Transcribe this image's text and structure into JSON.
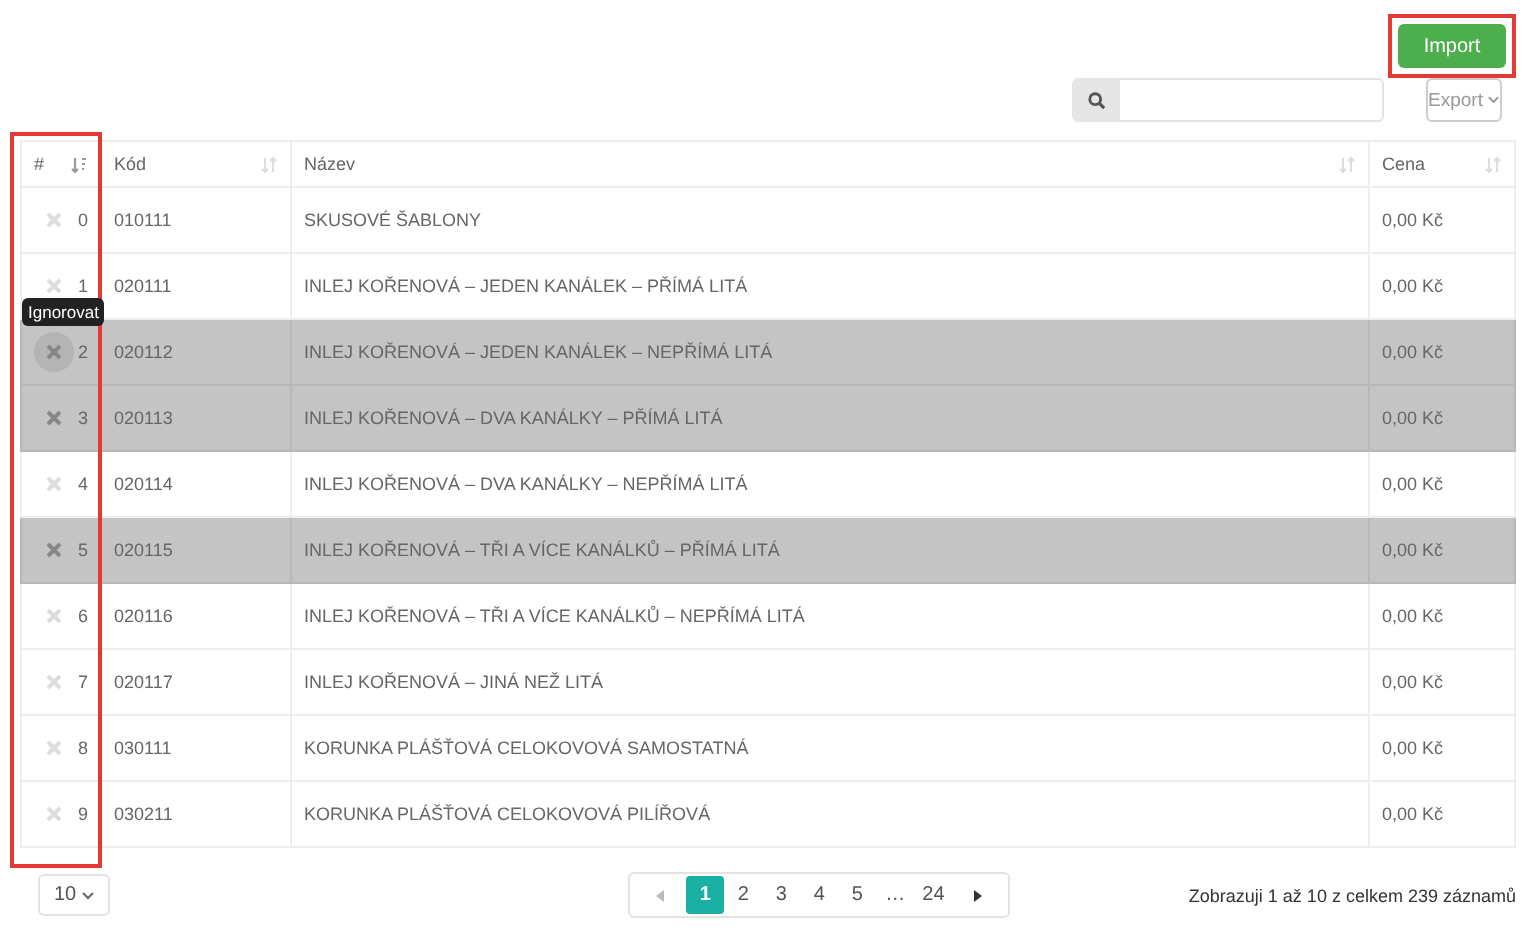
{
  "toolbar": {
    "import_button": {
      "label": "Import",
      "highlighted": true
    },
    "export_button": {
      "label": "Export"
    }
  },
  "table": {
    "first_column_highlighted": true,
    "columns": [
      {
        "label": "#",
        "sorted": true
      },
      {
        "label": "Kód",
        "sorted": false
      },
      {
        "label": "Název",
        "sorted": false
      },
      {
        "label": "Cena",
        "sorted": false
      }
    ],
    "rows": [
      {
        "index": "0",
        "code": "010111",
        "name": "SKUSOVÉ ŠABLONY",
        "price": "0,00 Kč",
        "ignored": false,
        "hovered": false
      },
      {
        "index": "1",
        "code": "020111",
        "name": "INLEJ KOŘENOVÁ – JEDEN KANÁLEK – PŘÍMÁ LITÁ",
        "price": "0,00 Kč",
        "ignored": false,
        "hovered": false
      },
      {
        "index": "2",
        "code": "020112",
        "name": "INLEJ KOŘENOVÁ – JEDEN KANÁLEK – NEPŘÍMÁ LITÁ",
        "price": "0,00 Kč",
        "ignored": true,
        "hovered": true
      },
      {
        "index": "3",
        "code": "020113",
        "name": "INLEJ KOŘENOVÁ – DVA KANÁLKY – PŘÍMÁ LITÁ",
        "price": "0,00 Kč",
        "ignored": true,
        "hovered": false
      },
      {
        "index": "4",
        "code": "020114",
        "name": "INLEJ KOŘENOVÁ – DVA KANÁLKY – NEPŘÍMÁ LITÁ",
        "price": "0,00 Kč",
        "ignored": false,
        "hovered": false
      },
      {
        "index": "5",
        "code": "020115",
        "name": "INLEJ KOŘENOVÁ – TŘI A VÍCE KANÁLKŮ – PŘÍMÁ LITÁ",
        "price": "0,00 Kč",
        "ignored": true,
        "hovered": false
      },
      {
        "index": "6",
        "code": "020116",
        "name": "INLEJ KOŘENOVÁ – TŘI A VÍCE KANÁLKŮ – NEPŘÍMÁ LITÁ",
        "price": "0,00 Kč",
        "ignored": false,
        "hovered": false
      },
      {
        "index": "7",
        "code": "020117",
        "name": "INLEJ KOŘENOVÁ – JINÁ NEŽ LITÁ",
        "price": "0,00 Kč",
        "ignored": false,
        "hovered": false
      },
      {
        "index": "8",
        "code": "030111",
        "name": "KORUNKA PLÁŠŤOVÁ CELOKOVOVÁ SAMOSTATNÁ",
        "price": "0,00 Kč",
        "ignored": false,
        "hovered": false
      },
      {
        "index": "9",
        "code": "030211",
        "name": "KORUNKA PLÁŠŤOVÁ CELOKOVOVÁ PILÍŘOVÁ",
        "price": "0,00 Kč",
        "ignored": false,
        "hovered": false
      }
    ]
  },
  "tooltip": {
    "text": "Ignorovat"
  },
  "footer": {
    "page_size": "10",
    "pages": [
      {
        "label": "1",
        "selected": true
      },
      {
        "label": "2",
        "selected": false
      },
      {
        "label": "3",
        "selected": false
      },
      {
        "label": "4",
        "selected": false
      },
      {
        "label": "5",
        "selected": false
      },
      {
        "label": "…",
        "selected": false
      },
      {
        "label": "24",
        "selected": false
      }
    ],
    "summary": "Zobrazuji 1 až 10 z celkem 239 záznamů"
  }
}
